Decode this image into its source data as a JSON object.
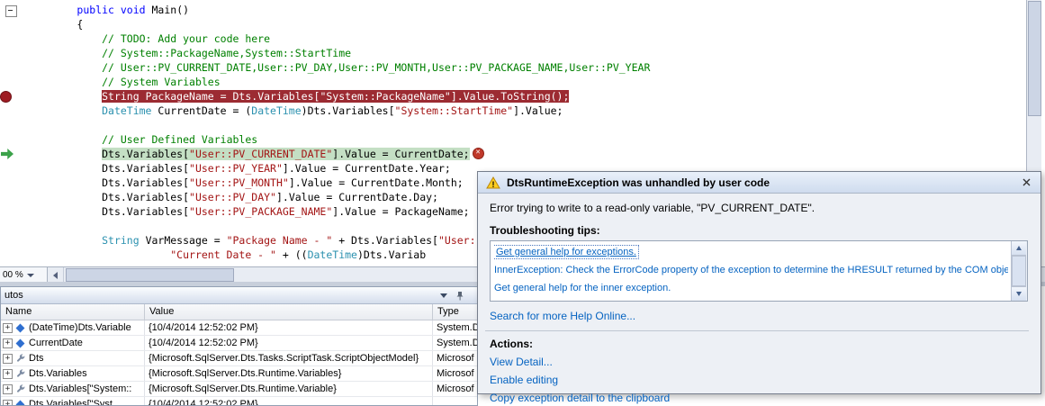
{
  "editor": {
    "zoom_label": "00 %",
    "lines": [
      {
        "ind": 8,
        "toks": [
          [
            "public",
            "k"
          ],
          [
            " ",
            "p"
          ],
          [
            "void",
            "k"
          ],
          [
            " Main()",
            "p"
          ]
        ]
      },
      {
        "ind": 8,
        "toks": [
          [
            "{",
            "p"
          ]
        ]
      },
      {
        "ind": 12,
        "toks": [
          [
            "// TODO: Add your code here",
            "c"
          ]
        ]
      },
      {
        "ind": 12,
        "toks": [
          [
            "// System::PackageName,System::StartTime",
            "c"
          ]
        ]
      },
      {
        "ind": 12,
        "toks": [
          [
            "// User::PV_CURRENT_DATE,User::PV_DAY,User::PV_MONTH,User::PV_PACKAGE_NAME,User::PV_YEAR",
            "c"
          ]
        ]
      },
      {
        "ind": 12,
        "toks": [
          [
            "// System Variables",
            "c"
          ]
        ]
      },
      {
        "ind": 12,
        "hl": "bp",
        "toks": [
          [
            "String",
            "t"
          ],
          [
            " PackageName = ",
            "p"
          ],
          [
            "Dts.Variables[",
            "p"
          ],
          [
            "\"System::PackageName\"",
            "s"
          ],
          [
            "].Value.ToString();",
            "p"
          ]
        ]
      },
      {
        "ind": 12,
        "toks": [
          [
            "DateTime",
            "t"
          ],
          [
            " CurrentDate = (",
            "p"
          ],
          [
            "DateTime",
            "t"
          ],
          [
            ")Dts.Variables[",
            "p"
          ],
          [
            "\"System::StartTime\"",
            "s"
          ],
          [
            "].Value;",
            "p"
          ]
        ]
      },
      {
        "ind": 0,
        "toks": []
      },
      {
        "ind": 12,
        "toks": [
          [
            "// User Defined Variables",
            "c"
          ]
        ]
      },
      {
        "ind": 12,
        "hl": "ex",
        "marker": true,
        "toks": [
          [
            "Dts.Variables[",
            "p"
          ],
          [
            "\"User::PV_CURRENT_DATE\"",
            "s"
          ],
          [
            "].Value = CurrentDate;",
            "p"
          ]
        ]
      },
      {
        "ind": 12,
        "toks": [
          [
            "Dts.Variables[",
            "p"
          ],
          [
            "\"User::PV_YEAR\"",
            "s"
          ],
          [
            "].Value = CurrentDate.Year;",
            "p"
          ]
        ]
      },
      {
        "ind": 12,
        "toks": [
          [
            "Dts.Variables[",
            "p"
          ],
          [
            "\"User::PV_MONTH\"",
            "s"
          ],
          [
            "].Value = CurrentDate.Month;",
            "p"
          ]
        ]
      },
      {
        "ind": 12,
        "toks": [
          [
            "Dts.Variables[",
            "p"
          ],
          [
            "\"User::PV_DAY\"",
            "s"
          ],
          [
            "].Value = CurrentDate.Day;",
            "p"
          ]
        ]
      },
      {
        "ind": 12,
        "toks": [
          [
            "Dts.Variables[",
            "p"
          ],
          [
            "\"User::PV_PACKAGE_NAME\"",
            "s"
          ],
          [
            "].Value = PackageName;",
            "p"
          ]
        ]
      },
      {
        "ind": 0,
        "toks": []
      },
      {
        "ind": 12,
        "toks": [
          [
            "String",
            "t"
          ],
          [
            " VarMessage = ",
            "p"
          ],
          [
            "\"Package Name - \"",
            "s"
          ],
          [
            " + Dts.Variables[",
            "p"
          ],
          [
            "\"User:",
            "s"
          ]
        ]
      },
      {
        "ind": 23,
        "toks": [
          [
            "\"Current Date - \"",
            "s"
          ],
          [
            " + ((",
            "p"
          ],
          [
            "DateTime",
            "t"
          ],
          [
            ")Dts.Variab",
            "p"
          ]
        ]
      }
    ]
  },
  "popup": {
    "title": "DtsRuntimeException was unhandled by user code",
    "message": "Error trying to write to a read-only variable, \"PV_CURRENT_DATE\".",
    "tips_header": "Troubleshooting tips:",
    "tips": [
      "Get general help for exceptions.",
      "InnerException: Check the ErrorCode property of the exception to determine the HRESULT returned by the COM object.",
      "Get general help for the inner exception."
    ],
    "search_link": "Search for more Help Online...",
    "actions_header": "Actions:",
    "actions": [
      "View Detail...",
      "Enable editing",
      "Copy exception detail to the clipboard"
    ]
  },
  "autos": {
    "title": "utos",
    "columns": [
      "Name",
      "Value",
      "Type"
    ],
    "rows": [
      {
        "icon": "field-icon",
        "name": "(DateTime)Dts.Variable",
        "value": "{10/4/2014 12:52:02 PM}",
        "type": "System.D"
      },
      {
        "icon": "field-icon",
        "name": "CurrentDate",
        "value": "{10/4/2014 12:52:02 PM}",
        "type": "System.D"
      },
      {
        "icon": "property-icon",
        "name": "Dts",
        "value": "{Microsoft.SqlServer.Dts.Tasks.ScriptTask.ScriptObjectModel}",
        "type": "Microsof"
      },
      {
        "icon": "property-icon",
        "name": "Dts.Variables",
        "value": "{Microsoft.SqlServer.Dts.Runtime.Variables}",
        "type": "Microsof"
      },
      {
        "icon": "property-icon",
        "name": "Dts.Variables[\"System::",
        "value": "{Microsoft.SqlServer.Dts.Runtime.Variable}",
        "type": "Microsof"
      },
      {
        "icon": "field-icon",
        "name": "Dts.Variables[\"Syst",
        "value": "{10/4/2014 12:52:02 PM}",
        "type": ""
      }
    ]
  },
  "colors": {
    "keyword": "#0000ff",
    "type_name": "#2b91af",
    "comment": "#008000",
    "string": "#a31515",
    "breakpoint_bg": "#9c2b32",
    "exception_bg": "#c4dfc4",
    "link": "#0563c1"
  }
}
